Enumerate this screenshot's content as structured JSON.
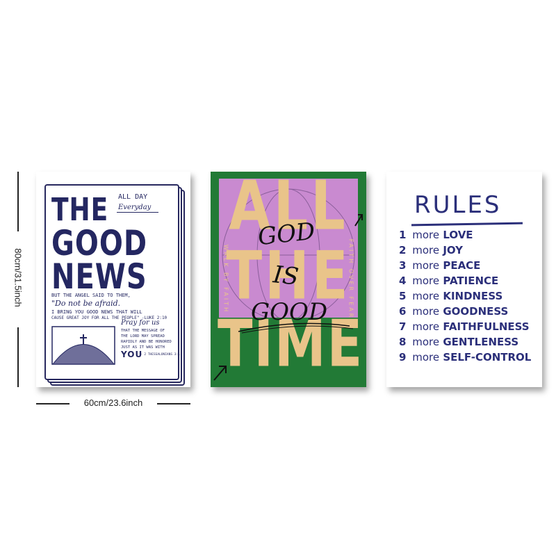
{
  "dimensions": {
    "width_label": "60cm/23.6inch",
    "height_label": "80cm/31.5inch"
  },
  "poster1": {
    "headline": [
      "THE",
      "GOOD",
      "NEWS"
    ],
    "corner": [
      "ALL DAY",
      "Everyday"
    ],
    "lead": "BUT THE ANGEL SAID TO THEM,",
    "quote": "\"Do not be afraid.",
    "verse": [
      "I BRING YOU GOOD NEWS THAT WILL",
      "CAUSE GREAT JOY FOR ALL THE PEOPLE\" -LUKE 2:10"
    ],
    "pray_title": "Pray for us",
    "pray_lines": [
      "THAT THE MESSAGE OF",
      "THE LORD MAY SPREAD",
      "RAPIDLY AND BE HONORED",
      "JUST AS IT WAS WITH"
    ],
    "you": "YOU",
    "ref": "- 2 THESSALONIANS 3:1",
    "colors": {
      "ink": "#242761",
      "paper": "#ffffff"
    }
  },
  "poster2": {
    "background_words": [
      "ALL",
      "THE",
      "TIME"
    ],
    "overlay": [
      "GOD",
      "IS",
      "GOOD"
    ],
    "side_left": "WALK BY FAITH",
    "side_right": "FAITH OVER FEAR",
    "colors": {
      "green": "#227a36",
      "pink": "#c98ad0",
      "tan": "#e9c48a",
      "ink": "#111111"
    }
  },
  "poster3": {
    "title": "RULES",
    "items": [
      {
        "num": "1",
        "more": "more",
        "word": "LOVE"
      },
      {
        "num": "2",
        "more": "more",
        "word": "JOY"
      },
      {
        "num": "3",
        "more": "more",
        "word": "PEACE"
      },
      {
        "num": "4",
        "more": "more",
        "word": "PATIENCE"
      },
      {
        "num": "5",
        "more": "more",
        "word": "KINDNESS"
      },
      {
        "num": "6",
        "more": "more",
        "word": "GOODNESS"
      },
      {
        "num": "7",
        "more": "more",
        "word": "FAITHFULNESS"
      },
      {
        "num": "8",
        "more": "more",
        "word": "GENTLENESS"
      },
      {
        "num": "9",
        "more": "more",
        "word": "SELF-CONTROL"
      }
    ],
    "colors": {
      "ink": "#2b2f7a"
    }
  }
}
